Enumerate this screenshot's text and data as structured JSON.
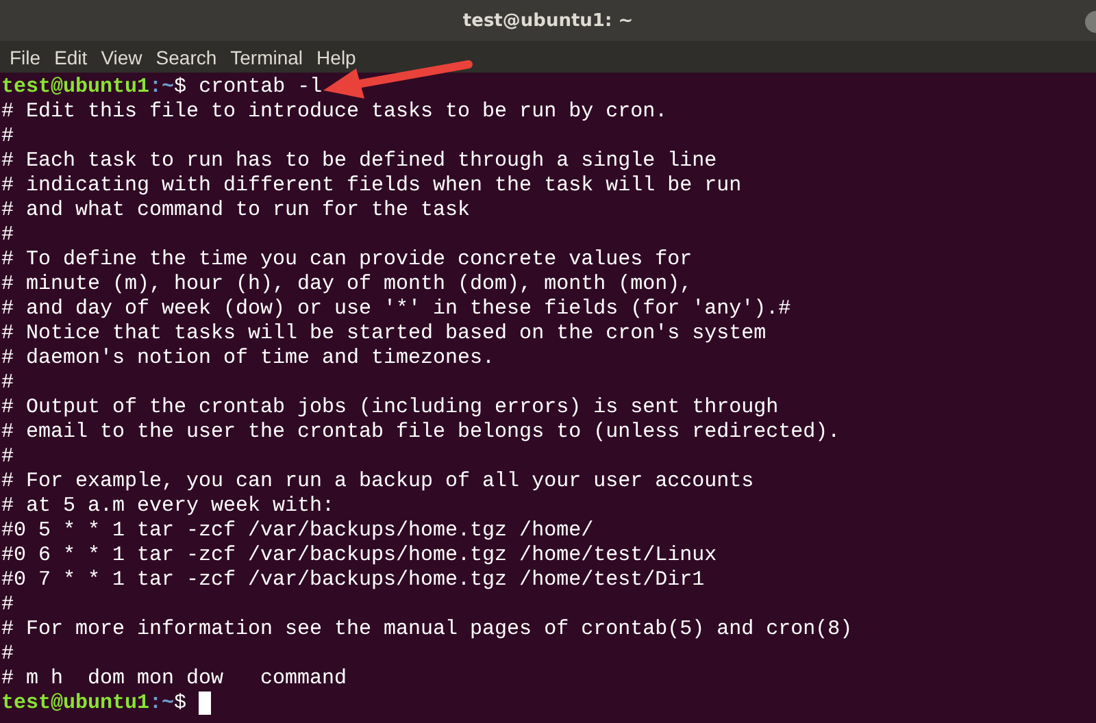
{
  "window": {
    "title": "test@ubuntu1: ~"
  },
  "menu": [
    "File",
    "Edit",
    "View",
    "Search",
    "Terminal",
    "Help"
  ],
  "lines": [
    {
      "kind": "prompt",
      "user": "test@ubuntu1",
      "path": ":~",
      "symbol": "$ ",
      "command": "crontab -l",
      "cursor": false
    },
    {
      "kind": "output",
      "text": "# Edit this file to introduce tasks to be run by cron."
    },
    {
      "kind": "output",
      "text": "#"
    },
    {
      "kind": "output",
      "text": "# Each task to run has to be defined through a single line"
    },
    {
      "kind": "output",
      "text": "# indicating with different fields when the task will be run"
    },
    {
      "kind": "output",
      "text": "# and what command to run for the task"
    },
    {
      "kind": "output",
      "text": "#"
    },
    {
      "kind": "output",
      "text": "# To define the time you can provide concrete values for"
    },
    {
      "kind": "output",
      "text": "# minute (m), hour (h), day of month (dom), month (mon),"
    },
    {
      "kind": "output",
      "text": "# and day of week (dow) or use '*' in these fields (for 'any').#"
    },
    {
      "kind": "output",
      "text": "# Notice that tasks will be started based on the cron's system"
    },
    {
      "kind": "output",
      "text": "# daemon's notion of time and timezones."
    },
    {
      "kind": "output",
      "text": "#"
    },
    {
      "kind": "output",
      "text": "# Output of the crontab jobs (including errors) is sent through"
    },
    {
      "kind": "output",
      "text": "# email to the user the crontab file belongs to (unless redirected)."
    },
    {
      "kind": "output",
      "text": "#"
    },
    {
      "kind": "output",
      "text": "# For example, you can run a backup of all your user accounts"
    },
    {
      "kind": "output",
      "text": "# at 5 a.m every week with:"
    },
    {
      "kind": "output",
      "text": "#0 5 * * 1 tar -zcf /var/backups/home.tgz /home/"
    },
    {
      "kind": "output",
      "text": "#0 6 * * 1 tar -zcf /var/backups/home.tgz /home/test/Linux"
    },
    {
      "kind": "output",
      "text": "#0 7 * * 1 tar -zcf /var/backups/home.tgz /home/test/Dir1"
    },
    {
      "kind": "output",
      "text": "#"
    },
    {
      "kind": "output",
      "text": "# For more information see the manual pages of crontab(5) and cron(8)"
    },
    {
      "kind": "output",
      "text": "#"
    },
    {
      "kind": "output",
      "text": "# m h  dom mon dow   command"
    },
    {
      "kind": "prompt",
      "user": "test@ubuntu1",
      "path": ":~",
      "symbol": "$ ",
      "cursor": true
    }
  ],
  "annotation": {
    "kind": "arrow"
  }
}
